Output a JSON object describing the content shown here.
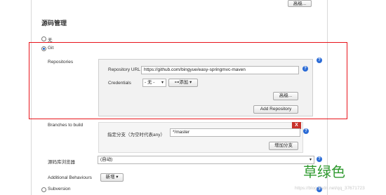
{
  "top": {
    "advanced_label": "高级..."
  },
  "section": {
    "title": "源码管理",
    "options": [
      "无",
      "Git",
      "Subversion"
    ]
  },
  "repositories": {
    "label": "Repositories",
    "url_label": "Repository URL",
    "url_value": "https://github.com/bingyue/easy-springmvc-maven",
    "credentials_label": "Credentials",
    "credentials_value": "- 无 -",
    "add_label": "添加",
    "advanced_label": "高级...",
    "add_repo_label": "Add Repository"
  },
  "branches": {
    "label": "Branches to build",
    "delete_label": "X",
    "spec_label": "指定分支（为空时代表any）",
    "spec_value": "*/master",
    "add_branch_label": "增加分支"
  },
  "browser": {
    "label": "源码库浏览器",
    "value": "(自动)"
  },
  "behaviours": {
    "label": "Additional Behaviours",
    "add_label": "新增"
  },
  "watermark": {
    "text": "草绿色",
    "url": "https://blog.csdn.net/qq_37671723"
  },
  "colors": {
    "highlight": "#e8141b",
    "help": "#2a6bd6",
    "delete": "#c8322b",
    "watermark": "#2f9a2f"
  }
}
